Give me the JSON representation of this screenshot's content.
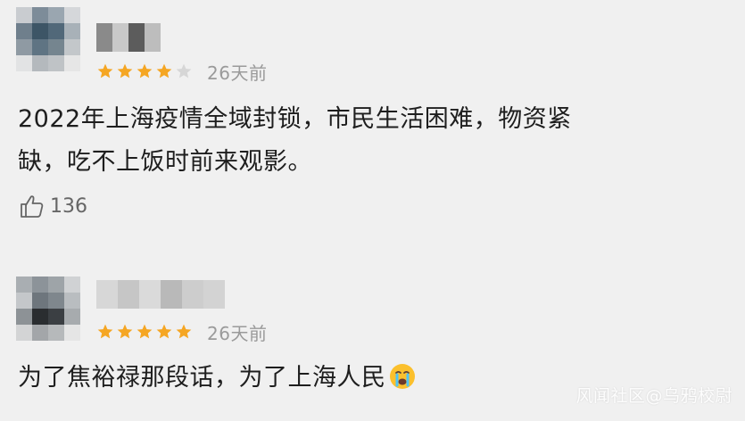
{
  "colors": {
    "star_filled": "#f5a623",
    "star_empty": "#d6d6d6",
    "background": "#f0f0f0",
    "text": "#1e1e1e",
    "meta": "#9a9a9a"
  },
  "reviews": [
    {
      "rating": 4,
      "max_rating": 5,
      "time": "26天前",
      "content_line1": "2022年上海疫情全域封锁，市民生活困难，物资紧",
      "content_line2": "缺，吃不上饭时前来观影。",
      "likes": "136",
      "like_icon": "thumbs-up-icon"
    },
    {
      "rating": 5,
      "max_rating": 5,
      "time": "26天前",
      "content": "为了焦裕禄那段话，为了上海人民",
      "emoji": "crying-face-emoji"
    }
  ],
  "watermark": "风闻社区@乌鸦校尉"
}
